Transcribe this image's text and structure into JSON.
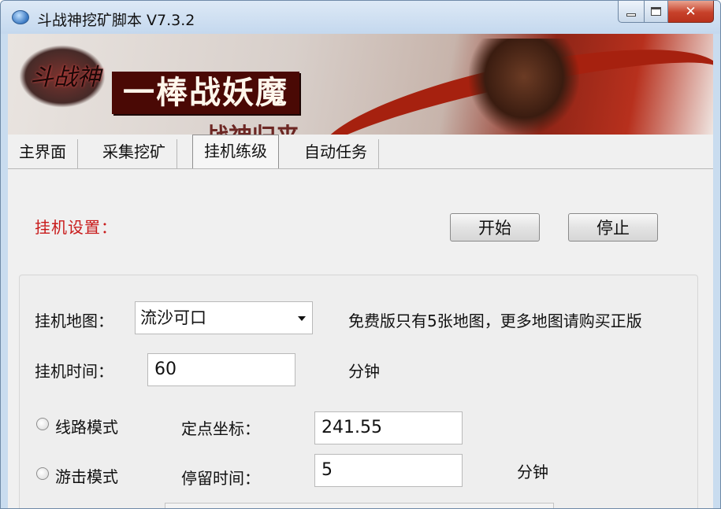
{
  "window": {
    "title": "斗战神挖矿脚本 V7.3.2",
    "icon": "app-icon",
    "controls": [
      "minimize-icon",
      "maximize-icon",
      "close-icon"
    ],
    "close_glyph": "✕"
  },
  "banner": {
    "slogan": "一棒战妖魔",
    "sub": "战神归来",
    "logo_text": "斗战神",
    "colors": {
      "accent": "#b7301d",
      "dark": "#4a0905"
    }
  },
  "tabs": [
    {
      "label": "主界面",
      "active": false
    },
    {
      "label": "采集挖矿",
      "active": false
    },
    {
      "label": "挂机练级",
      "active": true
    },
    {
      "label": "自动任务",
      "active": false
    }
  ],
  "settings": {
    "label": "挂机设置：",
    "label_color": "#c81a1a",
    "start_button": "开始",
    "stop_button": "停止"
  },
  "form": {
    "map_label": "挂机地图：",
    "map_selected": "流沙可口",
    "map_note": "免费版只有5张地图，更多地图请购买正版",
    "time_label": "挂机时间：",
    "time_value": "60",
    "time_unit": "分钟",
    "route_mode_label": "线路模式",
    "roam_mode_label": "游击模式",
    "fixed_point_label": "定点坐标：",
    "fixed_point_value": "241.55",
    "stay_time_label": "停留时间：",
    "stay_time_value": "5",
    "stay_time_unit": "分钟"
  }
}
